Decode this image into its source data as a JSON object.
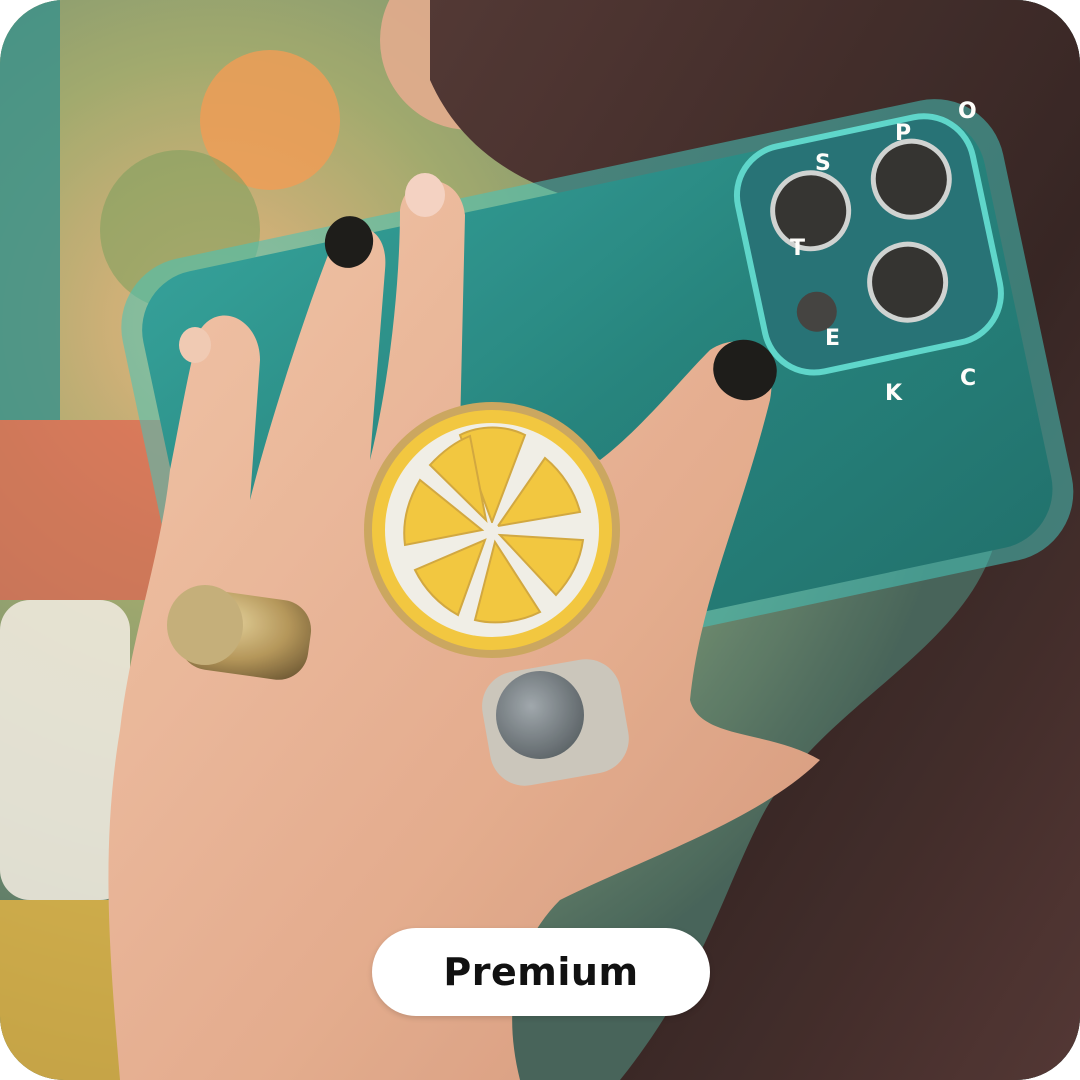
{
  "badge": {
    "label": "Premium"
  },
  "case_letters": [
    "S",
    "P",
    "O",
    "C",
    "K",
    "E",
    "T"
  ],
  "colors": {
    "phone_case": "#1f8f8a",
    "lemon_yellow": "#f3c63a",
    "lemon_white": "#f1f0ea",
    "nail_polish": "#111111",
    "hair": "#3a2424"
  },
  "icons": [
    "lemon-grip",
    "gold-ring",
    "stone-ring",
    "camera-lens"
  ]
}
